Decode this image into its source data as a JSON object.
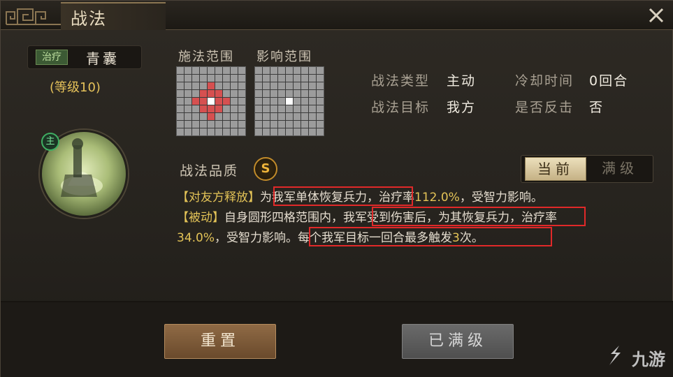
{
  "window": {
    "title": "战法"
  },
  "skill": {
    "type_badge": "治疗",
    "name": "青囊",
    "level": "(等级10)",
    "main_badge": "主"
  },
  "grids": {
    "cast_range_label": "施法范围",
    "effect_range_label": "影响范围"
  },
  "stats": {
    "type_key": "战法类型",
    "type_value": "主动",
    "target_key": "战法目标",
    "target_value": "我方",
    "cooldown_key": "冷却时间",
    "cooldown_value": "0回合",
    "counter_key": "是否反击",
    "counter_value": "否"
  },
  "quality": {
    "label": "战法品质",
    "grade": "S"
  },
  "toggle": {
    "current": "当前",
    "max": "满级"
  },
  "description": {
    "l1_tag": "【对友方释放】",
    "l1_hl": "为我军单体恢复兵力",
    "l1_a": "，治疗率",
    "l1_rate": "112.0%",
    "l1_b": "，受智力影响。",
    "l2_tag": "【被动】",
    "l2_a": "自身圆形四格范围内，",
    "l2_hl": "我军受到伤害后，为其恢复兵力",
    "l2_b": "，治疗率",
    "l3_rate": "34.0%",
    "l3_a": "，受智力影响。",
    "l3_hl_a": "每个我军目标一回合最多触发",
    "l3_hl_n": "3",
    "l3_hl_b": "次。"
  },
  "buttons": {
    "reset": "重置",
    "maxed": "已满级"
  },
  "watermark": "九游"
}
